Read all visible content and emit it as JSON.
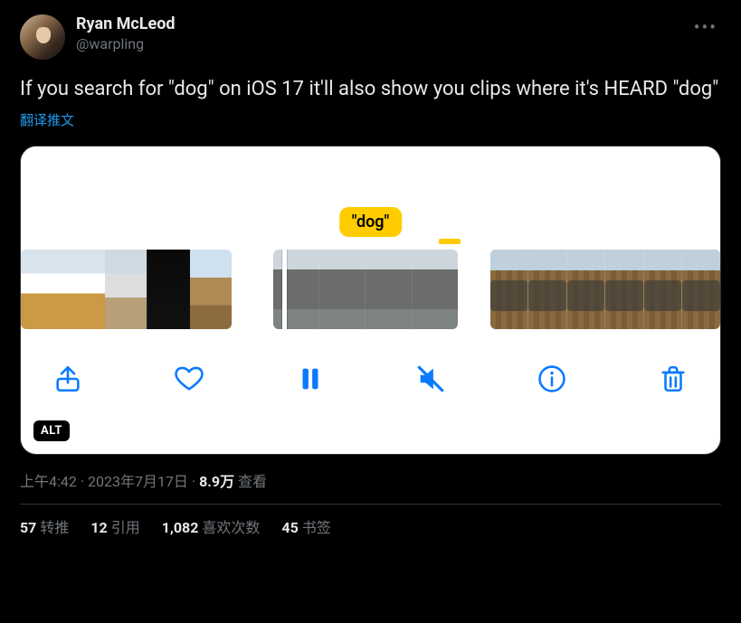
{
  "header": {
    "display_name": "Ryan McLeod",
    "username": "@warpling"
  },
  "body": {
    "text": "If you search for \"dog\" on iOS 17 it'll also show you clips where it's HEARD \"dog\"",
    "translate_label": "翻译推文"
  },
  "media": {
    "search_pill": "\"dog\"",
    "alt_badge": "ALT",
    "icons": {
      "share": "share-icon",
      "heart": "heart-icon",
      "pause": "pause-icon",
      "mute": "speaker-slash-icon",
      "info": "info-icon",
      "trash": "trash-icon"
    }
  },
  "meta": {
    "time": "上午4:42",
    "dot1": " · ",
    "date": "2023年7月17日",
    "dot2": " · ",
    "views_number": "8.9万",
    "views_label": " 查看"
  },
  "stats": {
    "retweets_count": "57",
    "retweets_label": "转推",
    "quotes_count": "12",
    "quotes_label": "引用",
    "likes_count": "1,082",
    "likes_label": "喜欢次数",
    "bookmarks_count": "45",
    "bookmarks_label": "书签"
  }
}
